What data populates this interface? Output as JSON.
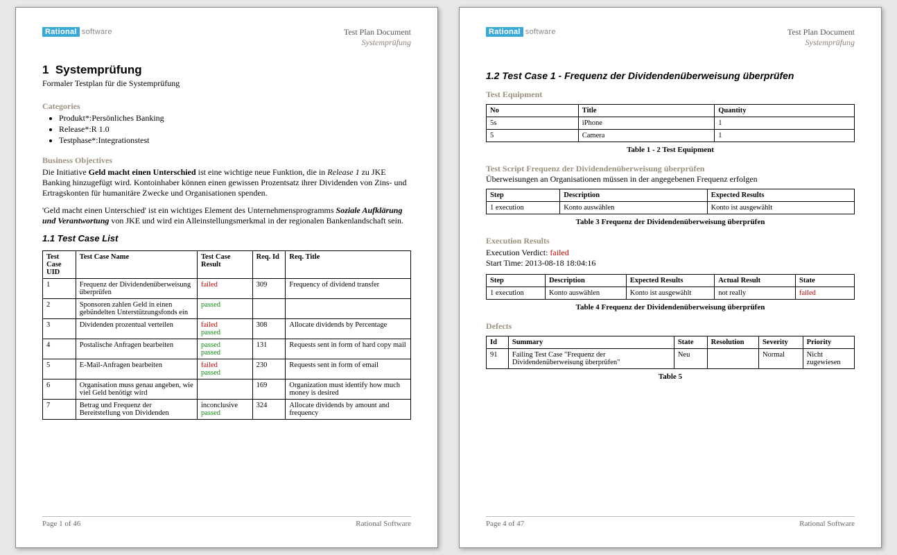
{
  "logo": {
    "left": "Rational",
    "right": "software"
  },
  "header": {
    "doc_title": "Test Plan Document",
    "subtitle": "Systemprüfung"
  },
  "page1": {
    "section_no": "1",
    "section_title": "Systemprüfung",
    "subtitle": "Formaler Testplan für die Systemprüfung",
    "categories_label": "Categories",
    "categories": [
      "Produkt*:Persönliches Banking",
      "Release*:R 1.0",
      "Testphase*:Integrationstest"
    ],
    "bo_label": "Business Objectives",
    "bo_p1_a": "Die Initiative ",
    "bo_p1_b": "Geld macht einen Unterschied",
    "bo_p1_c": " ist eine wichtige neue Funktion, die in ",
    "bo_p1_d": "Release 1",
    "bo_p1_e": " zu JKE Banking hinzugefügt wird. Kontoinhaber können einen gewissen Prozentsatz ihrer Dividenden von Zins- und Ertragskonten für humanitäre Zwecke und Organisationen spenden.",
    "bo_p2_a": "'Geld macht einen Unterschied' ist ein wichtiges Element des Unternehmensprogramms ",
    "bo_p2_b": "Soziale Aufklärung und Verantwortung",
    "bo_p2_c": " von JKE und wird ein Alleinstellungsmerkmal in der regionalen Bankenlandschaft sein.",
    "tcl_heading": "1.1  Test Case List",
    "tcl_headers": [
      "Test Case UID",
      "Test Case Name",
      "Test Case Result",
      "Req. Id",
      "Req. Title"
    ],
    "tcl_rows": [
      {
        "uid": "1",
        "name": "Frequenz der Dividendenüberweisung überprüfen",
        "results": [
          "failed"
        ],
        "req_id": "309",
        "req_title": "Frequency of dividend transfer"
      },
      {
        "uid": "2",
        "name": "Sponsoren zahlen Geld in einen gebündelten Unterstützungsfonds ein",
        "results": [
          "passed"
        ],
        "req_id": "",
        "req_title": ""
      },
      {
        "uid": "3",
        "name": "Dividenden prozentual verteilen",
        "results": [
          "failed",
          "passed"
        ],
        "req_id": "308",
        "req_title": "Allocate dividends by Percentage"
      },
      {
        "uid": "4",
        "name": "Postalische Anfragen bearbeiten",
        "results": [
          "passed",
          "passed"
        ],
        "req_id": "131",
        "req_title": "Requests sent in form of hard copy mail"
      },
      {
        "uid": "5",
        "name": "E-Mail-Anfragen bearbeiten",
        "results": [
          "failed",
          "passed"
        ],
        "req_id": "230",
        "req_title": "Requests sent in form of email"
      },
      {
        "uid": "6",
        "name": "Organisation muss genau angeben, wie viel Geld benötigt wird",
        "results": [],
        "req_id": "169",
        "req_title": "Organization must identify how much money is desired"
      },
      {
        "uid": "7",
        "name": "Betrag und Frequenz der Bereitstellung von Dividenden",
        "results": [
          "inconclusive",
          "passed"
        ],
        "req_id": "324",
        "req_title": "Allocate dividends by amount and frequency"
      }
    ],
    "footer_left": "Page 1 of  46",
    "footer_right": "Rational Software"
  },
  "page2": {
    "section_heading": "1.2  Test Case 1 - Frequenz der Dividendenüberweisung überprüfen",
    "te_label": "Test Equipment",
    "te_headers": [
      "No",
      "Title",
      "Quantity"
    ],
    "te_rows": [
      {
        "no": "5s",
        "title": "iPhone",
        "qty": "1"
      },
      {
        "no": "5",
        "title": "Camera",
        "qty": "1"
      }
    ],
    "te_caption": "Table 1 - 2 Test Equipment",
    "ts_label_a": "Test Script Frequenz der Dividendenüberweisung überprüfen",
    "ts_label_b": "Überweisungen an Organisationen müssen in der angegebenen Frequenz erfolgen",
    "ts_headers": [
      "Step",
      "Description",
      "Expected Results"
    ],
    "ts_rows": [
      {
        "step": "1 execution",
        "desc": "Konto auswählen",
        "exp": "Konto ist ausgewählt"
      }
    ],
    "ts_caption": "Table 3 Frequenz der Dividendenüberweisung überprüfen",
    "er_label": "Execution Results",
    "er_verdict_label": "Execution Verdict: ",
    "er_verdict": "failed",
    "er_start": "Start Time: 2013-08-18 18:04:16",
    "er_headers": [
      "Step",
      "Description",
      "Expected Results",
      "Actual Result",
      "State"
    ],
    "er_rows": [
      {
        "step": "1 execution",
        "desc": "Konto auswählen",
        "exp": "Konto ist ausgewählt",
        "act": "not really",
        "state": "failed"
      }
    ],
    "er_caption": "Table 4 Frequenz der Dividendenüberweisung überprüfen",
    "def_label": "Defects",
    "def_headers": [
      "Id",
      "Summary",
      "State",
      "Resolution",
      "Severity",
      "Priority"
    ],
    "def_rows": [
      {
        "id": "91",
        "summary": "Failing Test Case \"Frequenz der Dividendenüberweisung überprüfen\"",
        "state": "Neu",
        "resolution": "",
        "severity": "Normal",
        "priority": "Nicht zugewiesen"
      }
    ],
    "def_caption": "Table 5",
    "footer_left": "Page 4 of  47",
    "footer_right": "Rational Software"
  }
}
